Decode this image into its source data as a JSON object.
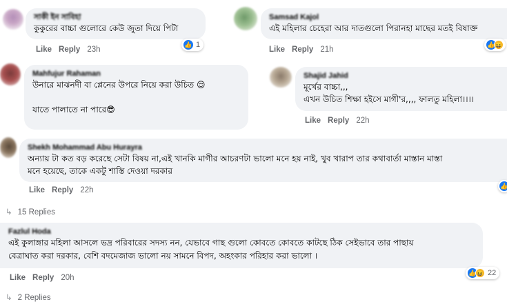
{
  "comments": [
    {
      "name": "সাকী ইন সাবিহা",
      "text": "কুকুরের বাচ্চা গুলোরে কেউ জুতা দিয়ে পিটা",
      "like": "Like",
      "reply": "Reply",
      "time": "23h",
      "reaction_count": "1"
    },
    {
      "name": "Samsad Kajol",
      "text": "এই মহিলার চেহেরা আর দাতগুলো পিরানহা মাছের মতই বিষাক্ত",
      "like": "Like",
      "reply": "Reply",
      "time": "21h"
    },
    {
      "name": "Mahfujur Rahaman",
      "text": "উনারে মাঝনদী বা প্লেনের উপরে নিয়ে করা উচিত 😌\n\nযাতে পালাতে না পারে😎"
    },
    {
      "name": "Shajid Jahid",
      "text": "মূর্খের বাচ্চা,,,\nএখন উচিত শিক্ষা হইসে মাগী'র,,,, ফালতু মহিলা।।।।",
      "like": "Like",
      "reply": "Reply",
      "time": "22h"
    },
    {
      "name": "Shekh Mohammad Abu Hurayra",
      "text": "অন্যায় টা কত বড় করেছে সেটা বিষয় না,এই খানকি মাগীর আচরণটা ভালো মনে হয় নাই, খুব খারাপ তার কথাবার্তা মাস্তান মাস্তা\nমনে হয়েছে, তাকে একটু শাস্তি দেওয়া দরকার",
      "like": "Like",
      "reply": "Reply",
      "time": "22h"
    },
    {
      "name": "Fazlul Hoda",
      "text": "এই কুলাঙ্গার মহিলা আসলে ভদ্র পরিবারের সদস্য নন, যেভাবে গাছ গুলো কোবতে কোবতে কাটছে ঠিক সেইভাবে তার পাছায়\nবেত্রাঘাত করা দরকার, বেশি বদমেজাজ ভালো নয় সামনে বিপদ, অহংকার পরিহার করা ভালো ।",
      "like": "Like",
      "reply": "Reply",
      "time": "20h",
      "reaction_count": "22"
    }
  ],
  "replies_1": "15 Replies",
  "replies_2": "2 Replies",
  "colors": {
    "bubble": "#f0f2f5",
    "meta": "#65676b",
    "like_blue": "#1877f2",
    "haha_yellow": "#f7b928"
  },
  "icons": [
    "like-icon",
    "haha-icon",
    "reply-arrow-icon"
  ]
}
